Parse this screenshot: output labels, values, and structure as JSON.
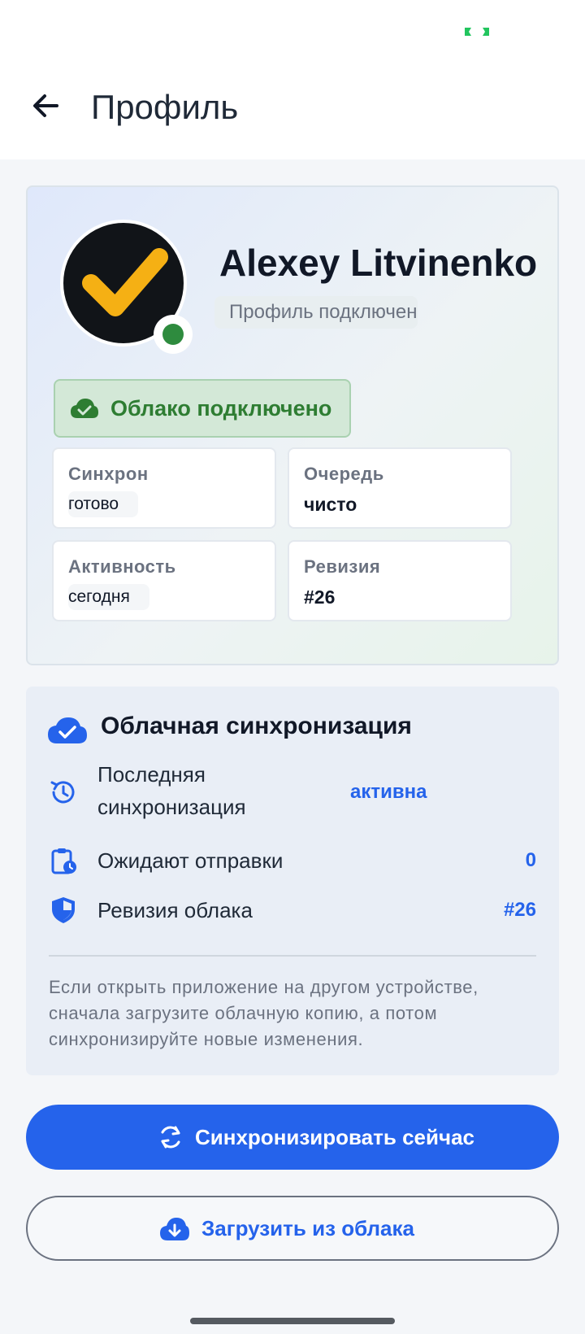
{
  "app": {
    "title": "Профиль",
    "accent": "#2563eb",
    "success": "#2e7d32"
  },
  "statusbar": {
    "indicator_icon": "green-bracket-indicator-icon"
  },
  "appbar": {
    "back_icon": "arrow-left-icon",
    "title": "Профиль"
  },
  "profile": {
    "avatar_icon": "yellow-checkmark-avatar-icon",
    "online_status_icon": "green-dot-icon",
    "name": "Alexey Litvinenko",
    "status": "Профиль подключен",
    "cloud_status": {
      "icon": "cloud-check-icon",
      "label": "Облако подключено"
    },
    "tiles": [
      {
        "label": "Синхрон",
        "value": "готово"
      },
      {
        "label": "Очередь",
        "value": "чисто"
      },
      {
        "label": "Активность",
        "value": "сегодня"
      },
      {
        "label": "Ревизия",
        "value": "#26"
      }
    ]
  },
  "sync_card": {
    "icon": "cloud-check-icon",
    "title": "Облачная синхронизация",
    "rows": [
      {
        "icon": "history-clock-icon",
        "label": "Последняя синхронизация",
        "value": "активна"
      },
      {
        "icon": "clipboard-clock-icon",
        "label": "Ожидают отправки",
        "value": "0"
      },
      {
        "icon": "shield-icon",
        "label": "Ревизия облака",
        "value": "#26"
      }
    ],
    "note": "Если открыть приложение на другом устройстве, сначала загрузите облачную копию, а потом синхронизируйте новые изменения."
  },
  "actions": {
    "sync_now": {
      "icon": "sync-icon",
      "label": "Синхронизировать сейчас"
    },
    "download": {
      "icon": "cloud-download-icon",
      "label": "Загрузить из облака"
    }
  }
}
